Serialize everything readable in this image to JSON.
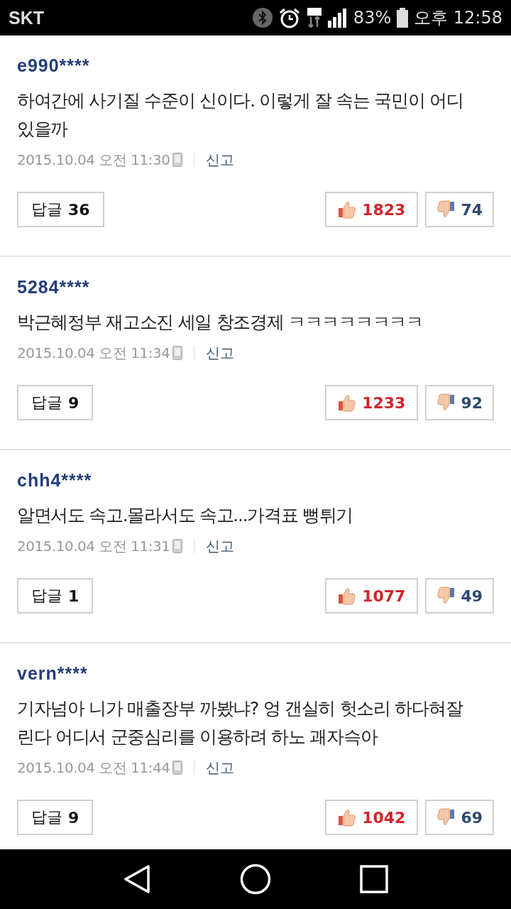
{
  "status_bar": {
    "carrier": "SKT",
    "battery": "83%",
    "time": "오후 12:58"
  },
  "comments": [
    {
      "user": "e990****",
      "text": "하여간에 사기질 수준이 신이다. 이렇게 잘 속는 국민이 어디 있을까",
      "date": "2015.10.04 오전 11:30",
      "report": "신고",
      "reply_label": "답글",
      "reply_count": "36",
      "likes": "1823",
      "dislikes": "74"
    },
    {
      "user": "5284****",
      "text": "박근혜정부 재고소진 세일 창조경제 ㅋㅋㅋㅋㅋㅋㅋㅋ",
      "date": "2015.10.04 오전 11:34",
      "report": "신고",
      "reply_label": "답글",
      "reply_count": "9",
      "likes": "1233",
      "dislikes": "92"
    },
    {
      "user": "chh4****",
      "text": "알면서도 속고.몰라서도 속고...가격표 뻥튀기",
      "date": "2015.10.04 오전 11:31",
      "report": "신고",
      "reply_label": "답글",
      "reply_count": "1",
      "likes": "1077",
      "dislikes": "49"
    },
    {
      "user": "vern****",
      "text": "기자넘아 니가 매출장부 까봤냐? 엉 갠실히 헛소리 하다혀잘 린다 어디서 군중심리를 이용하려 하노 괘자슥아",
      "date": "2015.10.04 오전 11:44",
      "report": "신고",
      "reply_label": "답글",
      "reply_count": "9",
      "likes": "1042",
      "dislikes": "69"
    }
  ]
}
